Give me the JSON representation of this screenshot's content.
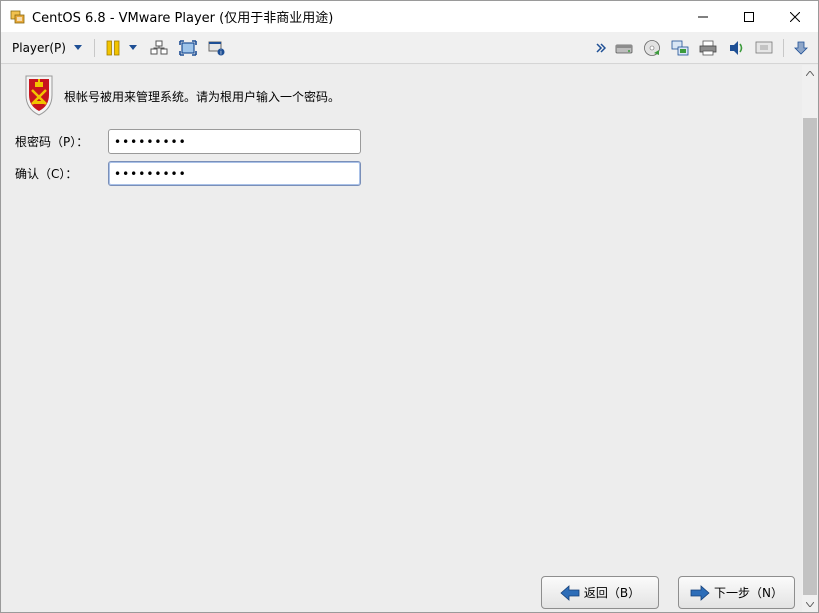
{
  "window": {
    "title": "CentOS 6.8 - VMware Player (仅用于非商业用途)",
    "app_icon": "vmware-icon"
  },
  "toolbar": {
    "player_menu": "Player(P)",
    "left_icons": [
      "pause-icon",
      "send-ctrl-alt-del-icon",
      "fullscreen-icon",
      "unity-icon"
    ],
    "right_icons": [
      "more-devices-icon",
      "hard-disk-icon",
      "cd-dvd-icon",
      "network-adapter-icon",
      "printer-icon",
      "sound-card-icon",
      "display-icon",
      "download-icon"
    ]
  },
  "installer": {
    "message": "根帐号被用来管理系统。请为根用户输入一个密码。",
    "root_password": {
      "label": "根密码（P）：",
      "value": "•••••••••"
    },
    "confirm_password": {
      "label": "确认（C）：",
      "value": "•••••••••"
    },
    "back_button": "返回（B）",
    "next_button": "下一步（N）"
  },
  "colors": {
    "accent": "#1e4f95",
    "background": "#ededed"
  }
}
